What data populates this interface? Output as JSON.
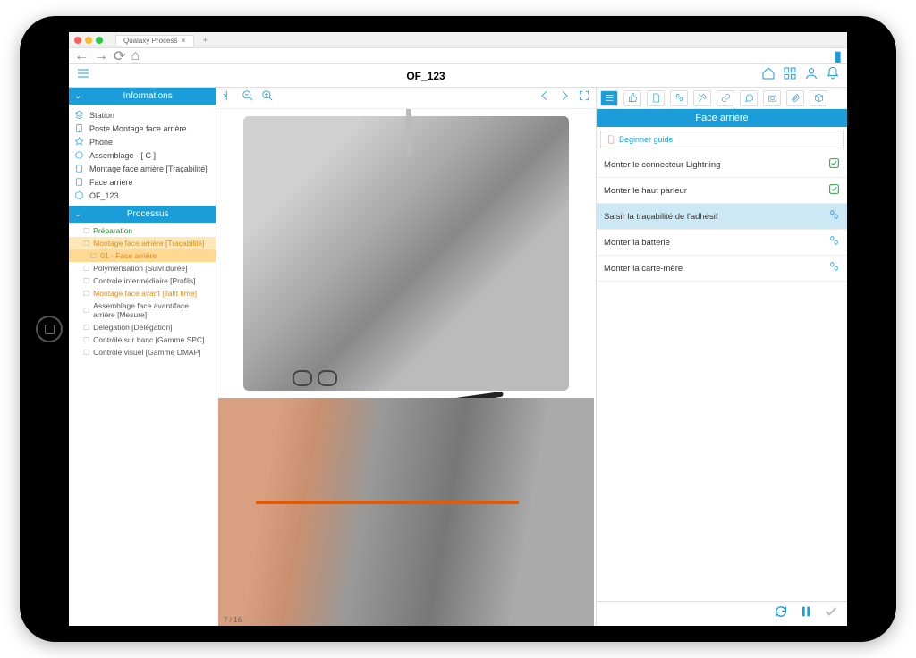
{
  "browser": {
    "tab_title": "Qualaxy Process"
  },
  "header": {
    "title": "OF_123"
  },
  "sidebar": {
    "panel1_title": "Informations",
    "info_items": [
      {
        "label": "Station"
      },
      {
        "label": "Poste Montage face arrière"
      },
      {
        "label": "Phone"
      },
      {
        "label": "Assemblage               - [ C ]"
      },
      {
        "label": "Montage face arrière [Traçabilité]"
      },
      {
        "label": "Face arrière"
      },
      {
        "label": "OF_123"
      }
    ],
    "panel2_title": "Processus",
    "proc_items": [
      {
        "label": "Préparation",
        "cls": "green"
      },
      {
        "label": "Montage face arrière [Traçabilité]",
        "cls": "orange hl"
      },
      {
        "label": "01 - Face arrière",
        "cls": "orange hl2"
      },
      {
        "label": "Polymérisation [Suivi durée]",
        "cls": ""
      },
      {
        "label": "Controle intermédiaire [Profils]",
        "cls": ""
      },
      {
        "label": "Montage face avant [Takt time]",
        "cls": "orange"
      },
      {
        "label": "Assemblage face avant/face arrière [Mesure]",
        "cls": ""
      },
      {
        "label": "Délégation [Délégation]",
        "cls": ""
      },
      {
        "label": "Contrôle sur banc [Gamme SPC]",
        "cls": ""
      },
      {
        "label": "Contrôle visuel [Gamme DMAP]",
        "cls": ""
      }
    ]
  },
  "center": {
    "page_indicator": "7 / 16"
  },
  "right": {
    "title": "Face arrière",
    "guide_label": "Beginner guide",
    "steps": [
      {
        "label": "Monter le connecteur Lightning",
        "status": "done"
      },
      {
        "label": "Monter le haut parleur",
        "status": "done"
      },
      {
        "label": "Saisir la traçabilité de l'adhésif",
        "status": "pending",
        "selected": true
      },
      {
        "label": "Monter la batterie",
        "status": "pending"
      },
      {
        "label": "Monter la carte-mère",
        "status": "pending"
      }
    ]
  }
}
